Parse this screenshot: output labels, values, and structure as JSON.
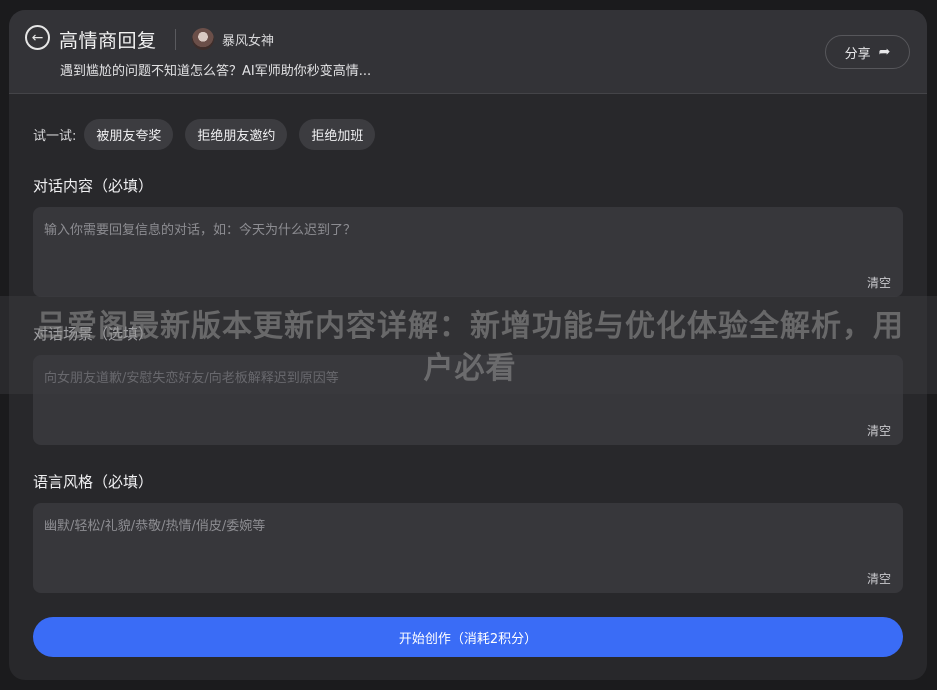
{
  "header": {
    "title": "高情商回复",
    "author": "暴风女神",
    "subtitle": "遇到尴尬的问题不知道怎么答？AI军师助你秒变高情...",
    "share_label": "分享",
    "back_icon": "back-arrow-icon",
    "share_icon": "share-arrow-icon"
  },
  "try": {
    "label": "试一试:",
    "chips": [
      "被朋友夸奖",
      "拒绝朋友邀约",
      "拒绝加班"
    ]
  },
  "fields": [
    {
      "label": "对话内容（必填）",
      "placeholder": "输入你需要回复信息的对话，如：今天为什么迟到了？",
      "clear": "清空"
    },
    {
      "label": "对话场景（选填）",
      "placeholder": "向女朋友道歉/安慰失恋好友/向老板解释迟到原因等",
      "clear": "清空"
    },
    {
      "label": "语言风格（必填）",
      "placeholder": "幽默/轻松/礼貌/恭敬/热情/俏皮/委婉等",
      "clear": "清空"
    }
  ],
  "submit_label": "开始创作（消耗2积分）",
  "watermark": "吕爱阁最新版本更新内容详解：新增功能与优化体验全解析，用户必看",
  "colors": {
    "accent": "#3a6cf6",
    "card": "#28282b",
    "field": "#37373b"
  }
}
